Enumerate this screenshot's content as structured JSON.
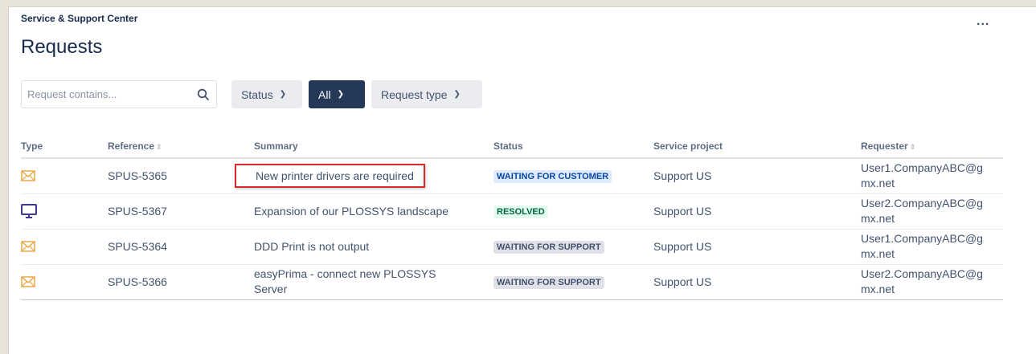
{
  "header": {
    "breadcrumb": "Service & Support Center",
    "title": "Requests",
    "more_label": "..."
  },
  "filters": {
    "search_placeholder": "Request contains...",
    "search_icon": "search-icon",
    "status_label": "Status",
    "all_label": "All",
    "request_type_label": "Request type"
  },
  "table": {
    "columns": [
      "Type",
      "Reference",
      "Summary",
      "Status",
      "Service project",
      "Requester"
    ],
    "rows": [
      {
        "type_icon": "email-icon",
        "reference": "SPUS-5365",
        "summary": "New printer drivers are required",
        "status": "WAITING FOR CUSTOMER",
        "project": "Support US",
        "requester_line1": "User1.CompanyABC@g",
        "requester_line2": "mx.net"
      },
      {
        "type_icon": "monitor-icon",
        "reference": "SPUS-5367",
        "summary": "Expansion of our PLOSSYS landscape",
        "status": "RESOLVED",
        "project": "Support US",
        "requester_line1": "User2.CompanyABC@g",
        "requester_line2": "mx.net"
      },
      {
        "type_icon": "email-icon",
        "reference": "SPUS-5364",
        "summary": "DDD Print is not output",
        "status": "WAITING FOR SUPPORT",
        "project": "Support US",
        "requester_line1": "User1.CompanyABC@g",
        "requester_line2": "mx.net"
      },
      {
        "type_icon": "email-icon",
        "reference": "SPUS-5366",
        "summary_line1": "easyPrima - connect new PLOSSYS",
        "summary_line2": "Server",
        "status": "WAITING FOR SUPPORT",
        "project": "Support US",
        "requester_line1": "User2.CompanyABC@g",
        "requester_line2": "mx.net"
      }
    ]
  },
  "colors": {
    "email_icon": "#e8a33d",
    "monitor_icon": "#3d3a8c",
    "highlight_box": "#d52b2b",
    "selected_filter": "#253858"
  }
}
